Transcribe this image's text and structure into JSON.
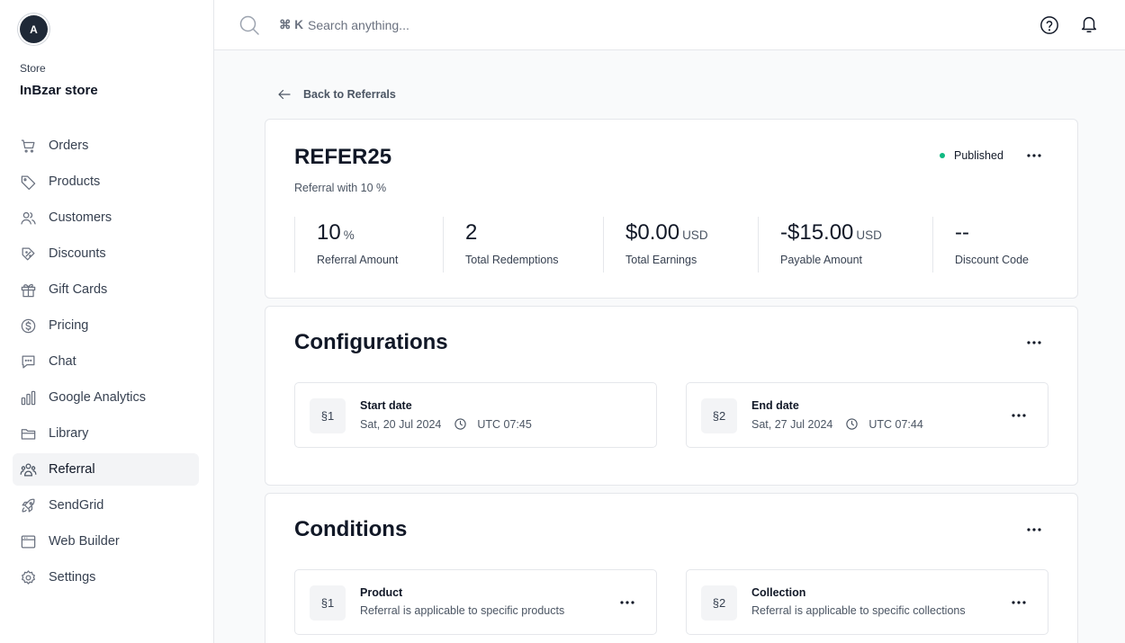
{
  "sidebar": {
    "avatar": "A",
    "store_label": "Store",
    "store_name": "InBzar store",
    "items": [
      {
        "label": "Orders",
        "icon": "cart-icon"
      },
      {
        "label": "Products",
        "icon": "tag-icon"
      },
      {
        "label": "Customers",
        "icon": "users-icon"
      },
      {
        "label": "Discounts",
        "icon": "discount-icon"
      },
      {
        "label": "Gift Cards",
        "icon": "gift-icon"
      },
      {
        "label": "Pricing",
        "icon": "dollar-circle-icon"
      },
      {
        "label": "Chat",
        "icon": "chat-icon"
      },
      {
        "label": "Google Analytics",
        "icon": "bar-chart-icon"
      },
      {
        "label": "Library",
        "icon": "folder-icon"
      },
      {
        "label": "Referral",
        "icon": "referral-users-icon"
      },
      {
        "label": "SendGrid",
        "icon": "rocket-icon"
      },
      {
        "label": "Web Builder",
        "icon": "browser-window-icon"
      },
      {
        "label": "Settings",
        "icon": "gear-icon"
      }
    ],
    "active_item": "Referral"
  },
  "header": {
    "shortcut": "⌘ K",
    "search_placeholder": "Search anything..."
  },
  "back_link": "Back to Referrals",
  "referral": {
    "code": "REFER25",
    "subtitle": "Referral with 10 %",
    "status": "Published",
    "status_color": "#10b981",
    "stats": [
      {
        "value": "10",
        "unit": "%",
        "label": "Referral Amount"
      },
      {
        "value": "2",
        "unit": "",
        "label": "Total Redemptions"
      },
      {
        "value": "$0.00",
        "unit": "USD",
        "label": "Total Earnings"
      },
      {
        "value": "-$15.00",
        "unit": "USD",
        "label": "Payable Amount"
      },
      {
        "value": "--",
        "unit": "",
        "label": "Discount Code"
      }
    ]
  },
  "configurations": {
    "title": "Configurations",
    "items": [
      {
        "badge": "§1",
        "title": "Start date",
        "date": "Sat, 20 Jul 2024",
        "time": "UTC 07:45"
      },
      {
        "badge": "§2",
        "title": "End date",
        "date": "Sat, 27 Jul 2024",
        "time": "UTC 07:44"
      }
    ]
  },
  "conditions": {
    "title": "Conditions",
    "items": [
      {
        "badge": "§1",
        "title": "Product",
        "description": "Referral is applicable to specific products"
      },
      {
        "badge": "§2",
        "title": "Collection",
        "description": "Referral is applicable to specific collections"
      }
    ]
  }
}
